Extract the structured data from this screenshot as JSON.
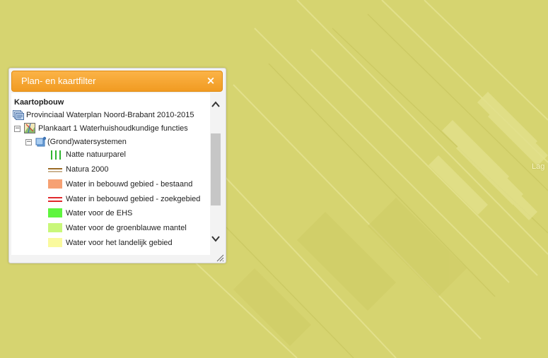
{
  "map": {
    "label": "Lag"
  },
  "panel": {
    "title": "Plan- en kaartfilter",
    "close_symbol": "×",
    "section_title": "Kaartopbouw",
    "plan": {
      "label": "Provinciaal Waterplan Noord-Brabant 2010-2015",
      "icon": "map-layers-icon"
    },
    "map_item": {
      "label": "Plankaart 1 Waterhuishoudkundige functies",
      "icon": "map-icon",
      "toggle": "−"
    },
    "group": {
      "label": "(Grond)watersystemen",
      "icon": "layer-group-icon",
      "toggle": "−"
    },
    "legend": [
      {
        "label": "Natte natuurparel",
        "icon": "green-vertical-lines-swatch",
        "color": "#2fb52f"
      },
      {
        "label": "Natura 2000",
        "icon": "brown-double-line-swatch",
        "color": "#9a6a25"
      },
      {
        "label": "Water in bebouwd gebied - bestaand",
        "icon": "orange-fill-swatch",
        "color": "#f6a173"
      },
      {
        "label": "Water in bebouwd gebied - zoekgebied",
        "icon": "red-double-line-swatch",
        "color": "#e0282c"
      },
      {
        "label": "Water voor de EHS",
        "icon": "green-fill-swatch",
        "color": "#5ff53f"
      },
      {
        "label": "Water voor de groenblauwe mantel",
        "icon": "light-green-fill-swatch",
        "color": "#c9f77a"
      },
      {
        "label": "Water voor het landelijk gebied",
        "icon": "yellow-fill-swatch",
        "color": "#fafa9e"
      }
    ]
  },
  "colors": {
    "map_bg": "#d8d673",
    "header_orange": "#f5a531"
  }
}
